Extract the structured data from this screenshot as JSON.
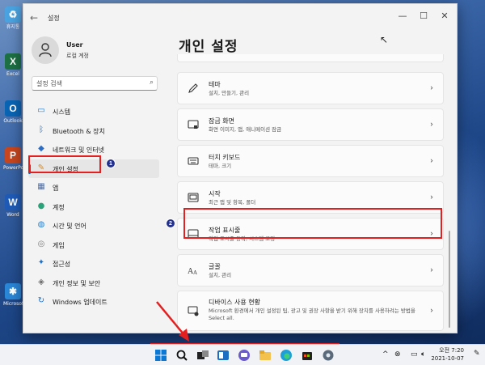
{
  "desktop": {
    "icons": [
      {
        "label": "휴지통",
        "glyph": "♻",
        "color": "#4aa3e0"
      },
      {
        "label": "Excel",
        "glyph": "X",
        "color": "#1d7044"
      },
      {
        "label": "Outlook",
        "glyph": "O",
        "color": "#0a64b4"
      },
      {
        "label": "PowerPoint",
        "glyph": "P",
        "color": "#c6461f"
      },
      {
        "label": "Word",
        "glyph": "W",
        "color": "#1f5bb6"
      },
      {
        "label": "Microsoft",
        "glyph": "✱",
        "color": "#2a86d6"
      }
    ]
  },
  "window": {
    "title": "설정",
    "controls": {
      "minimize": "—",
      "maximize": "☐",
      "close": "✕"
    }
  },
  "user": {
    "name": "User",
    "account": "로컬 계정"
  },
  "search": {
    "placeholder": "설정 검색"
  },
  "nav": [
    {
      "label": "시스템",
      "icon": "monitor-icon",
      "color": "#1a73c9"
    },
    {
      "label": "Bluetooth & 장치",
      "icon": "bluetooth-icon",
      "color": "#1a73c9"
    },
    {
      "label": "네트워크 및 인터넷",
      "icon": "wifi-icon",
      "color": "#2b6cc4"
    },
    {
      "label": "개인 설정",
      "icon": "brush-icon",
      "color": "#d38b2a"
    },
    {
      "label": "앱",
      "icon": "apps-icon",
      "color": "#4b6ea8"
    },
    {
      "label": "계정",
      "icon": "person-icon",
      "color": "#2aa37a"
    },
    {
      "label": "시간 및 언어",
      "icon": "globe-clock-icon",
      "color": "#1f7fd0"
    },
    {
      "label": "게임",
      "icon": "controller-icon",
      "color": "#7a7a7a"
    },
    {
      "label": "접근성",
      "icon": "accessibility-icon",
      "color": "#1a73c9"
    },
    {
      "label": "개인 정보 및 보안",
      "icon": "shield-icon",
      "color": "#6b6b6b"
    },
    {
      "label": "Windows 업데이트",
      "icon": "update-icon",
      "color": "#1a73c9"
    }
  ],
  "active_nav_index": 3,
  "page": {
    "title": "개인 설정"
  },
  "cards": [
    {
      "title": "테마",
      "desc": "설치, 만들기, 관리",
      "icon": "pen-icon"
    },
    {
      "title": "잠금 화면",
      "desc": "화면 이미지, 앱, 애니메이션 잠금",
      "icon": "lock-screen-icon"
    },
    {
      "title": "터치 키보드",
      "desc": "테마, 크기",
      "icon": "keyboard-icon"
    },
    {
      "title": "시작",
      "desc": "최근 앱 및 항목, 폴더",
      "icon": "start-icon"
    },
    {
      "title": "작업 표시줄",
      "desc": "작업 표시줄 동작, 시스템 고정",
      "icon": "taskbar-icon"
    },
    {
      "title": "글꼴",
      "desc": "설치, 관리",
      "icon": "font-icon"
    },
    {
      "title": "디바이스 사용 현황",
      "desc": "Microsoft 환경에서 개인 설정된 팁, 광고 및 권장 사항을 받기 위해 장치를 사용하려는 방법을 Select all.",
      "icon": "device-usage-icon"
    }
  ],
  "annotations": {
    "badge1": "1",
    "badge2": "2"
  },
  "taskbar": {
    "apps": [
      "windows-start-icon",
      "search-icon",
      "task-view-icon",
      "widgets-icon",
      "chat-icon",
      "file-explorer-icon",
      "edge-icon",
      "store-icon",
      "settings-icon"
    ],
    "time": "오전 7:20",
    "date": "2021-10-07"
  }
}
